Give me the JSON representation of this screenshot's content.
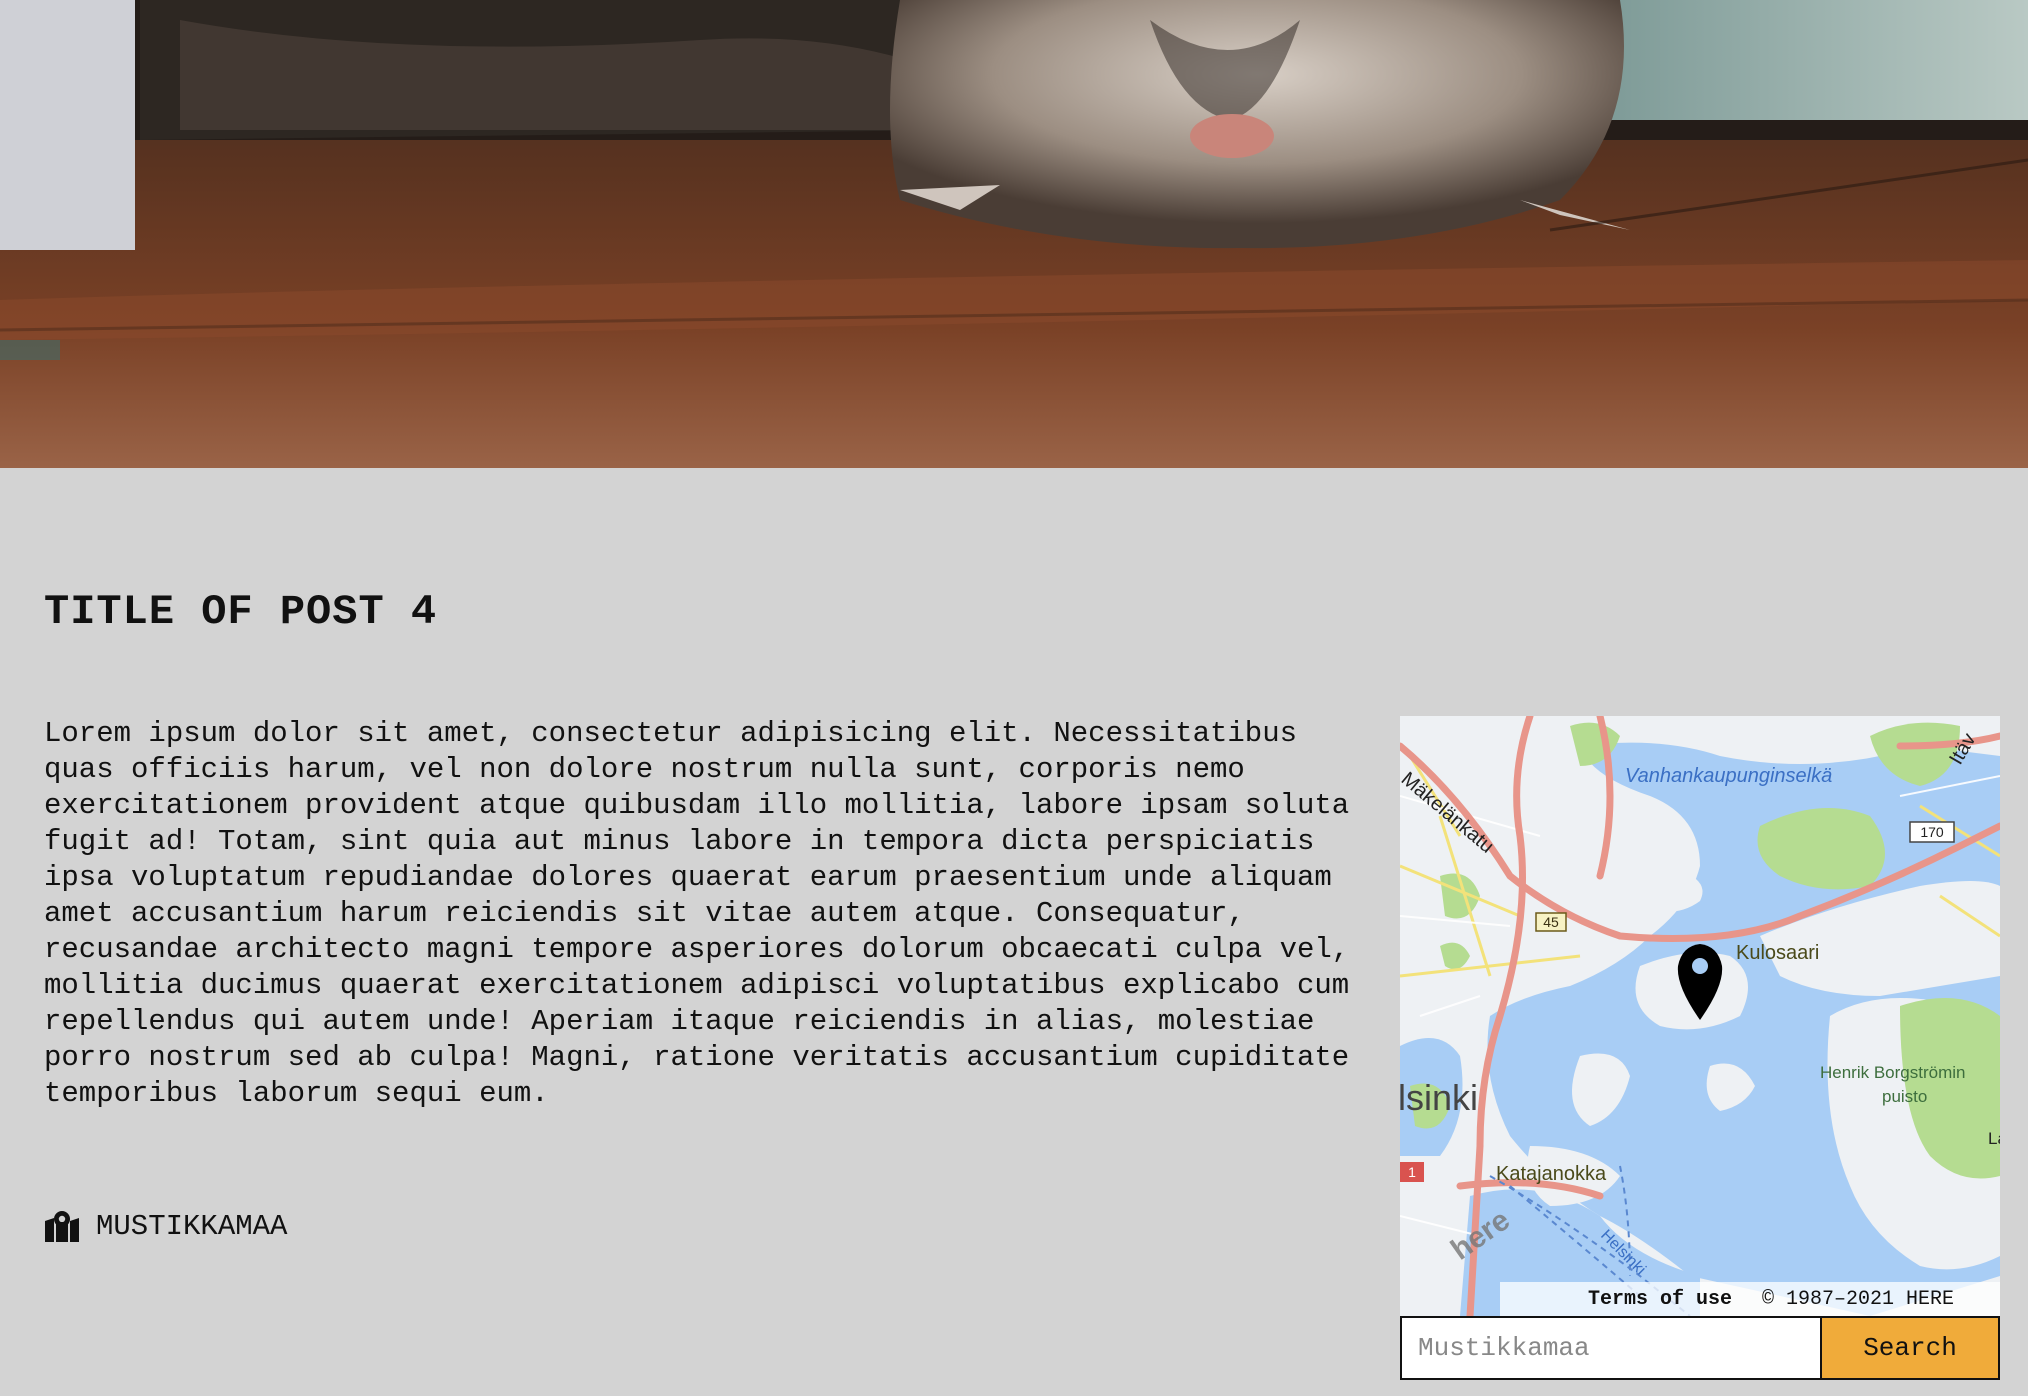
{
  "hero": {
    "image": "photo of a sleeping tabby cat lying on a wooden floor"
  },
  "post": {
    "title": "TITLE OF POST 4",
    "body": "Lorem ipsum dolor sit amet, consectetur adipisicing elit. Necessitatibus quas officiis harum, vel non dolore nostrum nulla sunt, corporis nemo exercitationem provident atque quibusdam illo mollitia, labore ipsam soluta fugit ad! Totam, sint quia aut minus labore in tempora dicta perspiciatis ipsa voluptatum repudiandae dolores quaerat earum praesentium unde aliquam amet accusantium harum reiciendis sit vitae autem atque. Consequatur, recusandae architecto magni tempore asperiores dolorum obcaecati culpa vel, mollitia ducimus quaerat exercitationem adipisci voluptatibus explicabo cum repellendus qui autem unde! Aperiam itaque reiciendis in alias, molestiae porro nostrum sed ab culpa! Magni, ratione veritatis accusantium cupiditate temporibus laborum sequi eum.",
    "location_icon": "map-pin-icon",
    "location": "MUSTIKKAMAA"
  },
  "map": {
    "labels": {
      "bay": "Vanhankaupunginselkä",
      "street": "Mäkelänkatu",
      "district": "Kulosaari",
      "park": "Henrik Borgströmin",
      "park2": "puisto",
      "city": "lsinki",
      "area": "Katajanokka",
      "road_45": "45",
      "road_170": "170",
      "road_1": "1",
      "edge_top": "Itäv",
      "edge_right": "La",
      "channel": "Helsinki",
      "logo": "here"
    },
    "terms_label": "Terms of use",
    "copyright": "© 1987–2021 HERE",
    "marker_icon": "map-marker-icon",
    "colors": {
      "water": "#a8cdf5",
      "land": "#eef1f4",
      "park": "#b5dc91",
      "road": "#e8958a",
      "minor_road": "#f3e27a"
    }
  },
  "search": {
    "placeholder": "Mustikkamaa",
    "button_label": "Search"
  }
}
